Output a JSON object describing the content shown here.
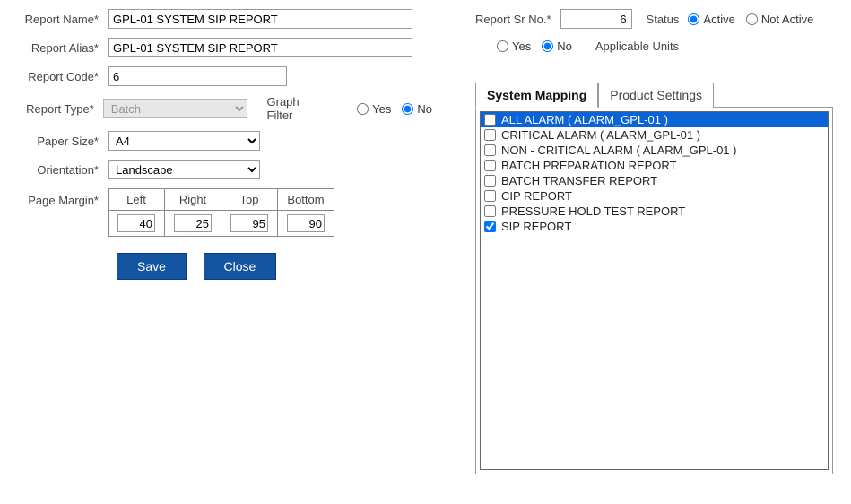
{
  "labels": {
    "reportName": "Report Name*",
    "reportAlias": "Report Alias*",
    "reportCode": "Report Code*",
    "reportType": "Report Type*",
    "paperSize": "Paper Size*",
    "orientation": "Orientation*",
    "pageMargin": "Page Margin*",
    "graphFilter": "Graph Filter",
    "reportSrNo": "Report Sr No.*",
    "status": "Status",
    "active": "Active",
    "notActive": "Not Active",
    "yes": "Yes",
    "no": "No",
    "applicableUnits": "Applicable  Units",
    "save": "Save",
    "close": "Close",
    "left": "Left",
    "right": "Right",
    "top": "Top",
    "bottom": "Bottom"
  },
  "values": {
    "reportName": "GPL-01 SYSTEM SIP REPORT",
    "reportAlias": "GPL-01 SYSTEM SIP REPORT",
    "reportCode": "6",
    "reportType": "Batch",
    "paperSize": "A4",
    "orientation": "Landscape",
    "marginLeft": "40",
    "marginRight": "25",
    "marginTop": "95",
    "marginBottom": "90",
    "reportSrNo": "6"
  },
  "tabs": {
    "systemMapping": "System Mapping",
    "productSettings": "Product Settings"
  },
  "mappingList": [
    {
      "label": "ALL  ALARM ( ALARM_GPL-01 )",
      "checked": false,
      "selected": true
    },
    {
      "label": "CRITICAL  ALARM ( ALARM_GPL-01 )",
      "checked": false,
      "selected": false
    },
    {
      "label": "NON - CRITICAL  ALARM ( ALARM_GPL-01 )",
      "checked": false,
      "selected": false
    },
    {
      "label": "BATCH PREPARATION REPORT",
      "checked": false,
      "selected": false
    },
    {
      "label": "BATCH TRANSFER REPORT",
      "checked": false,
      "selected": false
    },
    {
      "label": "CIP REPORT",
      "checked": false,
      "selected": false
    },
    {
      "label": "PRESSURE HOLD TEST REPORT",
      "checked": false,
      "selected": false
    },
    {
      "label": "SIP REPORT",
      "checked": true,
      "selected": false
    }
  ]
}
